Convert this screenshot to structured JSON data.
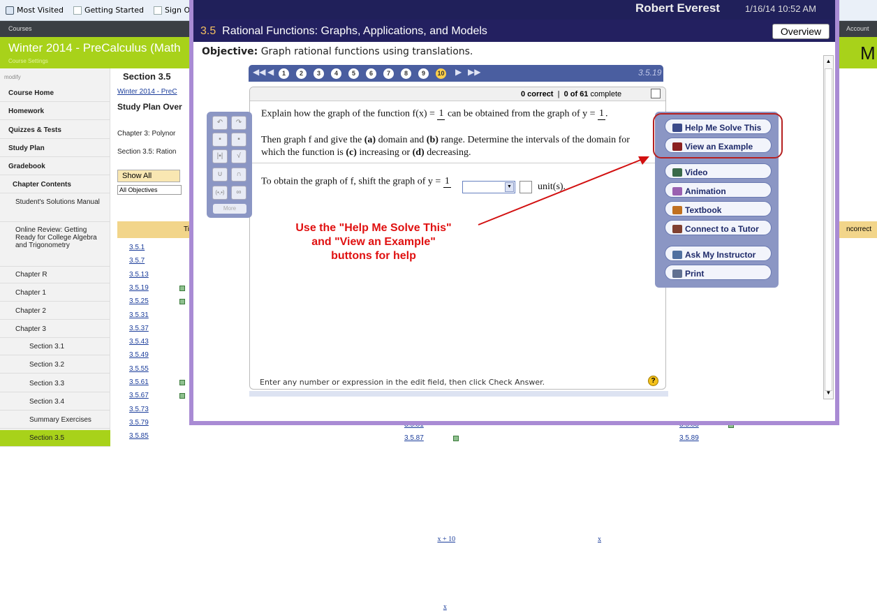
{
  "bookmarks": {
    "most_visited": "Most Visited",
    "getting_started": "Getting Started",
    "sign_out": "Sign Ou"
  },
  "topbar": {
    "courses": "Courses",
    "account": "Account"
  },
  "course": {
    "title": "Winter 2014 - PreCalculus (Math",
    "subtitle": "Course Settings",
    "right_letter": "M"
  },
  "sidebar": {
    "modify": "modify",
    "items": [
      "Course Home",
      "Homework",
      "Quizzes & Tests",
      "Study Plan",
      "Gradebook",
      "Chapter Contents",
      "Student's Solutions Manual",
      "Online Review: Getting Ready for College Algebra and Trigonometry",
      "Chapter R",
      "Chapter 1",
      "Chapter 2",
      "Chapter 3",
      "Section 3.1",
      "Section 3.2",
      "Section 3.3",
      "Section 3.4",
      "Summary Exercises",
      "Section 3.5"
    ]
  },
  "bg": {
    "section_title": "Section 3.5",
    "breadcrumb": "Winter 2014 - PreC",
    "study_plan": "Study Plan Over",
    "chapter3": "Chapter 3: Polynor",
    "section35": "Section 3.5: Ration",
    "show_all": "Show All",
    "show_short": "Sh",
    "all_objectives": "All Objectives",
    "tim": "Tim",
    "incorrect": "ncorrect",
    "links": [
      "3.5.1",
      "3.5.7",
      "3.5.13",
      "3.5.19",
      "3.5.25",
      "3.5.31",
      "3.5.37",
      "3.5.43",
      "3.5.49",
      "3.5.55",
      "3.5.61",
      "3.5.67",
      "3.5.73",
      "3.5.79",
      "3.5.85"
    ],
    "mid_links": [
      "3.5.81",
      "3.5.87"
    ],
    "right_links": [
      "3.5.83",
      "3.5.89"
    ]
  },
  "modal": {
    "user": "Robert Everest",
    "datetime": "1/16/14 10:52 AM",
    "section_num": "3.5",
    "title": "Rational Functions: Graphs, Applications, and Models",
    "overview": "Overview",
    "objective_label": "Objective:",
    "objective": "Graph rational functions using translations.",
    "question_numbers": [
      "1",
      "2",
      "3",
      "4",
      "5",
      "6",
      "7",
      "8",
      "9",
      "10"
    ],
    "current_id": "3.5.19",
    "correct": "0 correct",
    "complete_count": "0 of 61",
    "complete_word": "complete"
  },
  "question": {
    "p1a": "Explain how the graph of the function f(x) =",
    "f_num": "1",
    "f_den": "x + 10",
    "p1b": "can be obtained from the graph of y =",
    "y_num": "1",
    "y_den": "x",
    "p1c": ".",
    "p2a": "Then graph f and give the",
    "a": "(a)",
    "p2b": "domain and",
    "b": "(b)",
    "p2c": "range. Determine the intervals of the domain for",
    "p3a": "which the function is",
    "c": "(c)",
    "p3b": "increasing or",
    "d": "(d)",
    "p3c": "decreasing.",
    "ans_a": "To obtain the graph of f, shift the graph of y =",
    "ans_b": "unit(s).",
    "hint": "Enter any number or expression in the edit field, then click Check Answer."
  },
  "tools": {
    "more": "More"
  },
  "help": {
    "buttons": [
      "Help Me Solve This",
      "View an Example",
      "Video",
      "Animation",
      "Textbook",
      "Connect to a Tutor",
      "Ask My Instructor",
      "Print"
    ]
  },
  "annotation": {
    "line1": "Use the \"Help Me Solve This\"",
    "line2": "and \"View an Example\"",
    "line3": "buttons for help"
  }
}
